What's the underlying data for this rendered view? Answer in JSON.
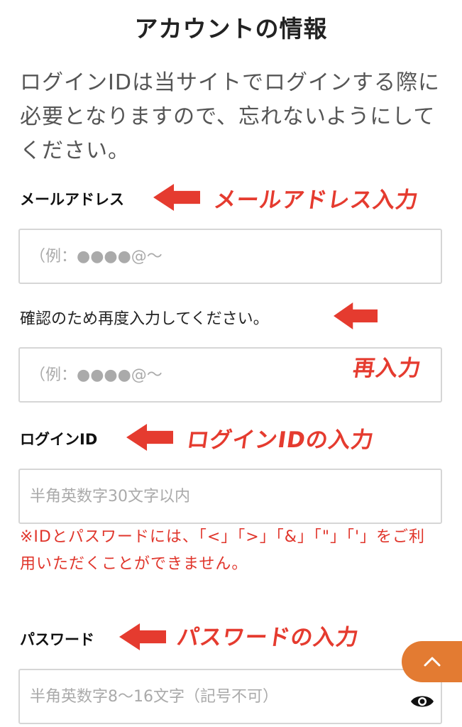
{
  "page_title": "アカウントの情報",
  "intro": "ログインIDは当サイトでログインする際に必要となりますので、忘れないようにしてください。",
  "email": {
    "label": "メールアドレス",
    "placeholder": "（例：●●●●@〜",
    "annotation": "メールアドレス入力"
  },
  "email_confirm": {
    "label": "確認のため再度入力してください。",
    "placeholder": "（例：●●●●@〜",
    "annotation": "再入力"
  },
  "login_id": {
    "label": "ログインID",
    "placeholder": "半角英数字30文字以内",
    "annotation": "ログインIDの入力"
  },
  "warning": "※IDとパスワードには、「<」「>」「&」「\"」「'」をご利用いただくことができません。",
  "password": {
    "label": "パスワード",
    "placeholder": "半角英数字8〜16文字（記号不可）",
    "annotation": "パスワードの入力"
  },
  "icons": {
    "scroll_top": "chevron-up-icon",
    "show_password": "eye-icon"
  },
  "colors": {
    "annotation_red": "#e53b2f",
    "warning_red": "#e0352b",
    "scroll_button": "#e37b32",
    "field_border": "#d6d6d6"
  }
}
